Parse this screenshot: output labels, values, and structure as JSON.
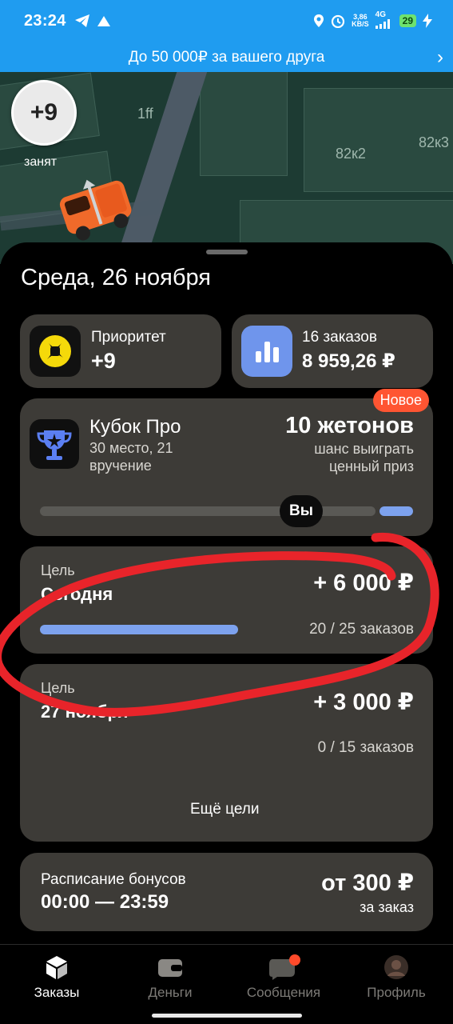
{
  "status_bar": {
    "time": "23:24",
    "speed_value": "3,86",
    "speed_unit": "KB/S",
    "network": "4G",
    "battery": "29"
  },
  "banner": {
    "text": "До 50 000₽ за вашего друга"
  },
  "map": {
    "labels": [
      "1ff",
      "82к2",
      "82к3"
    ],
    "priority_bubble": "+9",
    "driver_status": "занят"
  },
  "sheet": {
    "date": "Среда, 26 ноября",
    "priority_tile": {
      "label": "Приоритет",
      "value": "+9"
    },
    "orders_tile": {
      "label": "16 заказов",
      "value": "8 959,26 ₽"
    },
    "cup": {
      "badge": "Новое",
      "title": "Кубок Про",
      "subtitle_1": "30 место, 21",
      "subtitle_2": "вручение",
      "tokens": "10 жетонов",
      "desc_1": "шанс выиграть",
      "desc_2": "ценный приз",
      "you_label": "Вы"
    },
    "goals": [
      {
        "kicker": "Цель",
        "title": "Сегодня",
        "reward": "+ 6 000 ₽",
        "progress_text": "20 / 25 заказов",
        "progress": 0.8
      },
      {
        "kicker": "Цель",
        "title": "27 ноября",
        "reward": "+ 3 000 ₽",
        "progress_text": "0 / 15 заказов",
        "progress": 0
      }
    ],
    "more_goals": "Ещё цели",
    "bonus": {
      "title": "Расписание бонусов",
      "time": "00:00 — 23:59",
      "price": "от 300 ₽",
      "per": "за заказ"
    }
  },
  "tabbar": {
    "tabs": [
      {
        "label": "Заказы",
        "active": true
      },
      {
        "label": "Деньги",
        "active": false
      },
      {
        "label": "Сообщения",
        "active": false
      },
      {
        "label": "Профиль",
        "active": false
      }
    ]
  },
  "colors": {
    "accent_blue": "#1f9cf0",
    "card_bg": "#3d3b37",
    "progress_fill": "#7da2ee",
    "badge_red": "#ff5532",
    "annotation_red": "#e8242a"
  }
}
